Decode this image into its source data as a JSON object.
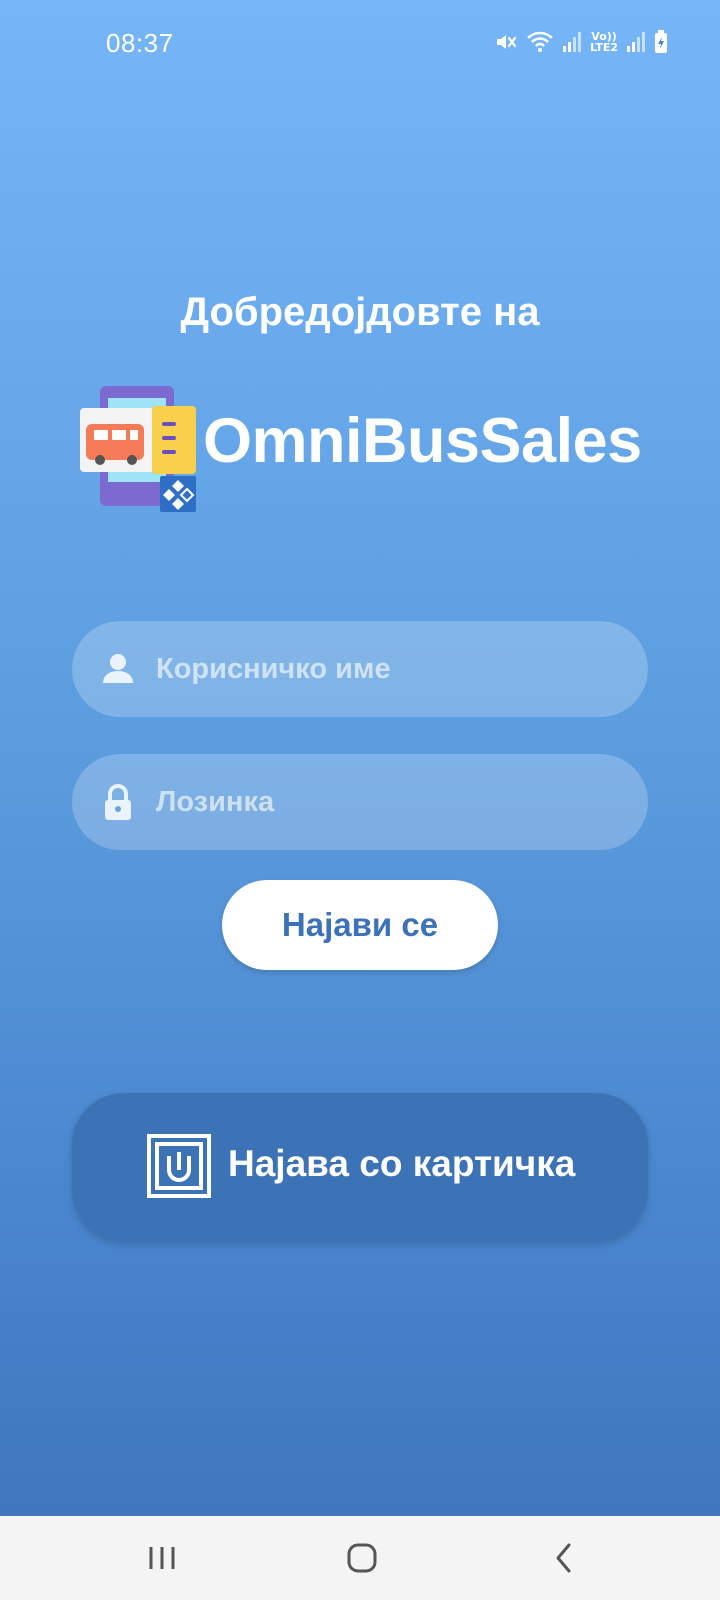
{
  "status_bar": {
    "time": "08:37",
    "icons": [
      "mute-icon",
      "wifi-icon",
      "signal-icon",
      "volte-lte2-icon",
      "signal-icon",
      "battery-charging-icon"
    ],
    "lte_top": "Vo))",
    "lte_bottom": "LTE2"
  },
  "login": {
    "welcome": "Добредојдовте на",
    "brand": "OmniBusSales",
    "username_placeholder": "Корисничко име",
    "username_value": "",
    "password_placeholder": "Лозинка",
    "password_value": "",
    "login_button": "Најави се",
    "card_button": "Најава со картичка"
  },
  "navigation": {
    "buttons": [
      "recent-apps-icon",
      "home-icon",
      "back-icon"
    ]
  },
  "colors": {
    "bg_top": "#76b6f8",
    "bg_bottom": "#3d72b8",
    "accent": "#3d72b8",
    "card_button": "#3c73b7",
    "text": "#ffffff"
  }
}
